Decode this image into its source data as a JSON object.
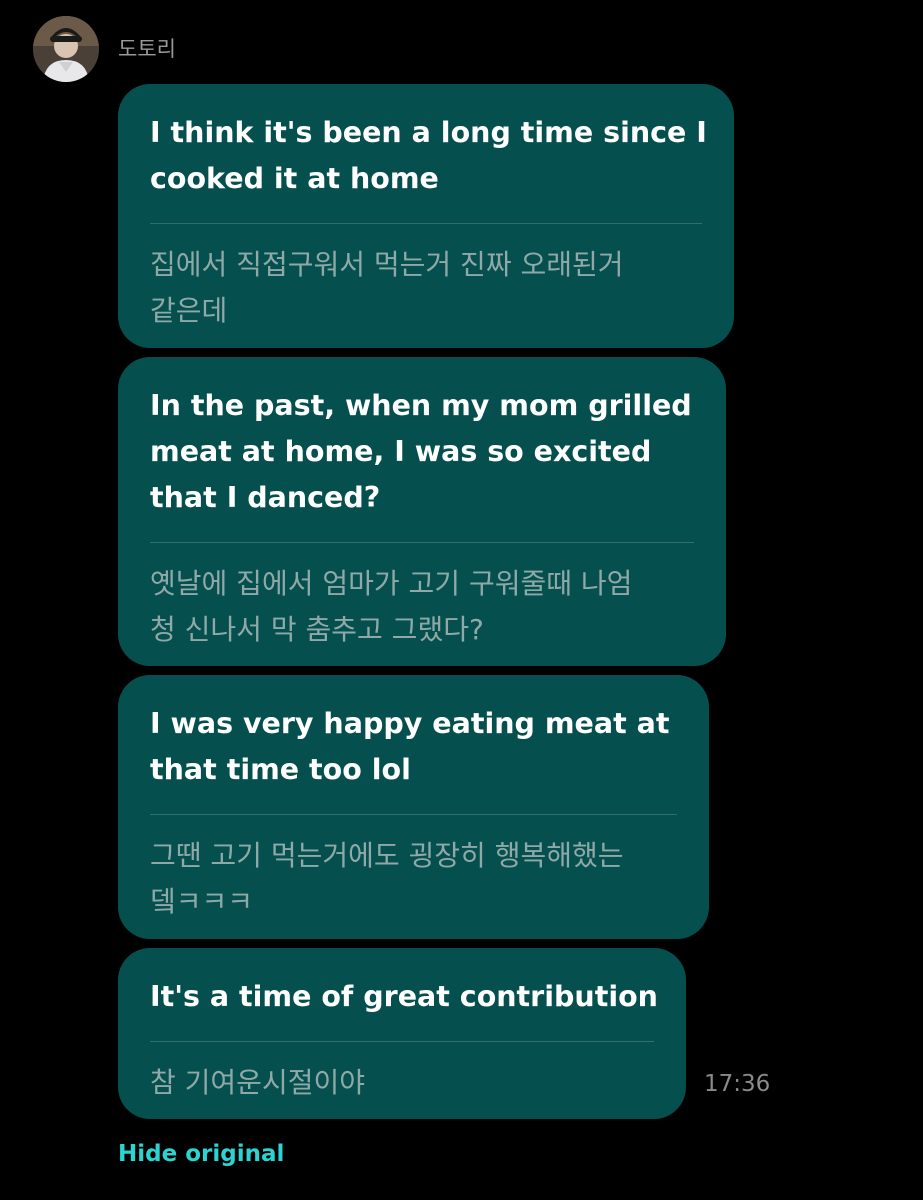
{
  "sender": {
    "name": "도토리",
    "avatar_icon": "profile-photo"
  },
  "messages": [
    {
      "original": [
        "I think it's been a long time since I",
        "cooked it at home"
      ],
      "translation": [
        "집에서 직접구워서 먹는거 진짜 오래된거",
        "같은데"
      ]
    },
    {
      "original": [
        "In the past, when my mom grilled",
        "meat at home, I was so excited",
        "that I danced?"
      ],
      "translation": [
        "옛날에 집에서 엄마가 고기 구워줄때 나엄",
        "청 신나서 막 춤추고 그랬다?"
      ]
    },
    {
      "original": [
        "I was very happy eating meat at",
        "that time too lol"
      ],
      "translation": [
        "그땐 고기 먹는거에도 굉장히 행복해했는",
        "뎈ㅋㅋㅋ"
      ]
    },
    {
      "original": [
        "It's a time of great contribution"
      ],
      "translation": [
        "참 기여운시절이야"
      ]
    }
  ],
  "timestamp": "17:36",
  "hide_original_label": "Hide original",
  "colors": {
    "background": "#000000",
    "bubble": "#05504f",
    "link": "#2bd4d0"
  }
}
